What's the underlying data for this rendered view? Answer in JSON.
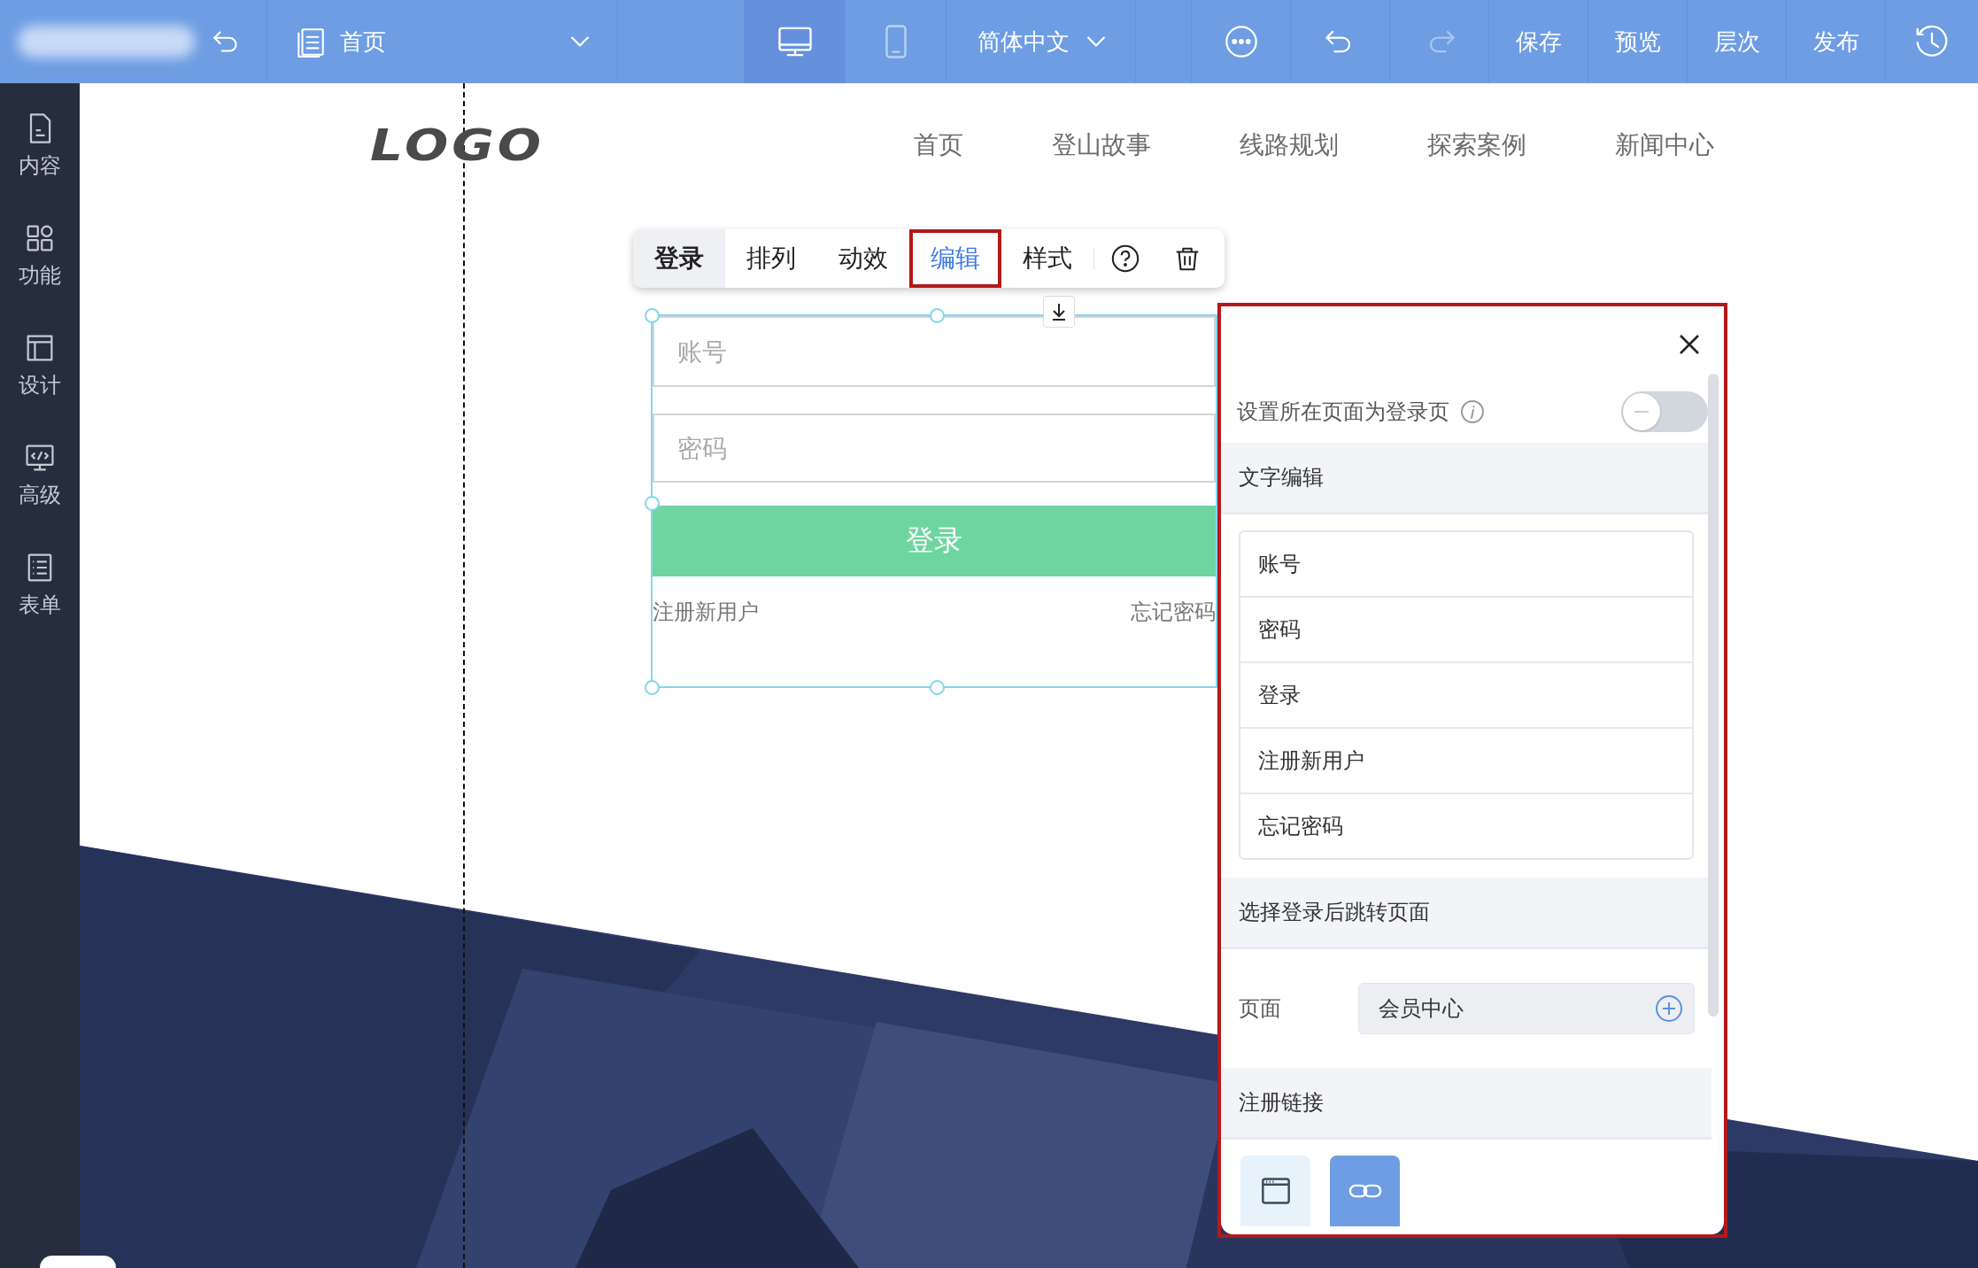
{
  "topbar": {
    "page_select": {
      "value": "首页"
    },
    "devices": [
      {
        "kind": "desktop",
        "selected": true
      },
      {
        "kind": "mobile",
        "selected": false
      }
    ],
    "language": {
      "value": "简体中文"
    },
    "tools": [
      {
        "kind": "more",
        "disabled": false
      },
      {
        "kind": "undo",
        "disabled": false
      },
      {
        "kind": "redo",
        "disabled": true
      }
    ],
    "buttons": [
      "保存",
      "预览",
      "层次",
      "发布"
    ]
  },
  "sidebar": {
    "items": [
      {
        "label": "内容"
      },
      {
        "label": "功能"
      },
      {
        "label": "设计"
      },
      {
        "label": "高级"
      },
      {
        "label": "表单"
      }
    ]
  },
  "site": {
    "logo": "LOGO",
    "nav": [
      "首页",
      "登山故事",
      "线路规划",
      "探索案例",
      "新闻中心"
    ]
  },
  "toolbar": {
    "component": "登录",
    "tabs": [
      {
        "label": "排列",
        "selected": false,
        "highlighted": false
      },
      {
        "label": "动效",
        "selected": false,
        "highlighted": false
      },
      {
        "label": "编辑",
        "selected": true,
        "highlighted": true
      },
      {
        "label": "样式",
        "selected": false,
        "highlighted": false
      }
    ]
  },
  "login_form": {
    "account_placeholder": "账号",
    "password_placeholder": "密码",
    "submit": "登录",
    "register_link": "注册新用户",
    "forgot_link": "忘记密码"
  },
  "panel": {
    "highlighted": true,
    "login_page_toggle": {
      "label": "设置所在页面为登录页",
      "on": false
    },
    "text_edit": {
      "title": "文字编辑",
      "items": [
        "账号",
        "密码",
        "登录",
        "注册新用户",
        "忘记密码"
      ]
    },
    "redirect": {
      "title": "选择登录后跳转页面",
      "label": "页面",
      "value": "会员中心"
    },
    "register_link": {
      "title": "注册链接",
      "options": [
        {
          "kind": "page",
          "selected": false
        },
        {
          "kind": "link",
          "selected": true
        }
      ]
    }
  }
}
